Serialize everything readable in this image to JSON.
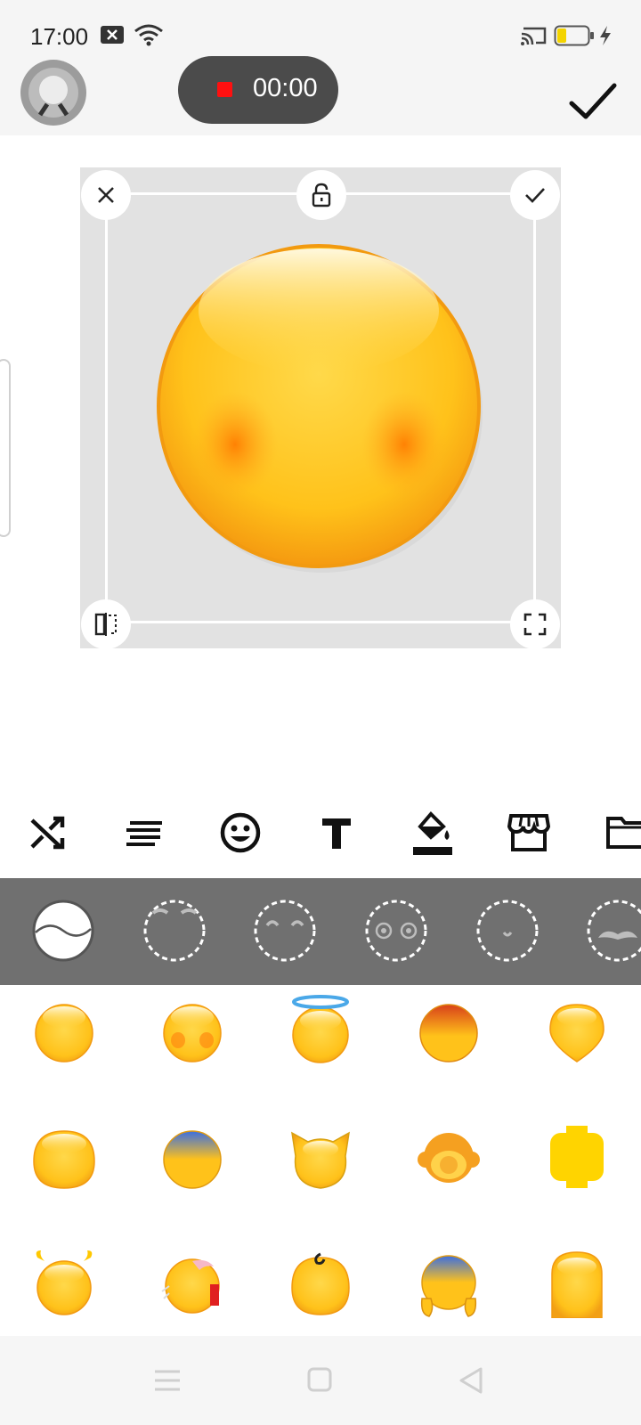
{
  "status_bar": {
    "time": "17:00",
    "icons": [
      "notification-x-icon",
      "wifi-icon",
      "cast-icon",
      "battery-icon",
      "charging-bolt-icon"
    ]
  },
  "top_bar": {
    "recording_time": "00:00",
    "avatar_icon": "avatar-icon",
    "confirm_icon": "checkmark-icon"
  },
  "editor": {
    "corner_controls": [
      "close-icon",
      "lock-icon",
      "check-icon",
      "flip-icon",
      "expand-icon"
    ],
    "face": "blushing-faceless-emoji"
  },
  "tools": [
    "shuffle-icon",
    "align-icon",
    "emoji-face-icon",
    "text-icon",
    "fill-color-icon",
    "store-icon",
    "folder-icon"
  ],
  "features": [
    "face-shape",
    "eyebrows",
    "eyes-closed",
    "eyes",
    "mouth",
    "mustache"
  ],
  "grid_items": [
    "plain-face",
    "blush-face",
    "halo-face",
    "red-top-face",
    "pointed-face",
    "wide-face",
    "blue-top-face",
    "cat-face",
    "monkey-face",
    "lego-face",
    "horned-face",
    "bandaged-face",
    "curl-face",
    "blue-hands-face",
    "tall-face"
  ],
  "colors": {
    "emoji_yellow": "#ffc21a",
    "emoji_orange": "#f59a10",
    "record_red": "#ff1010",
    "feature_bar": "#707070",
    "pill": "#4b4b4b"
  }
}
